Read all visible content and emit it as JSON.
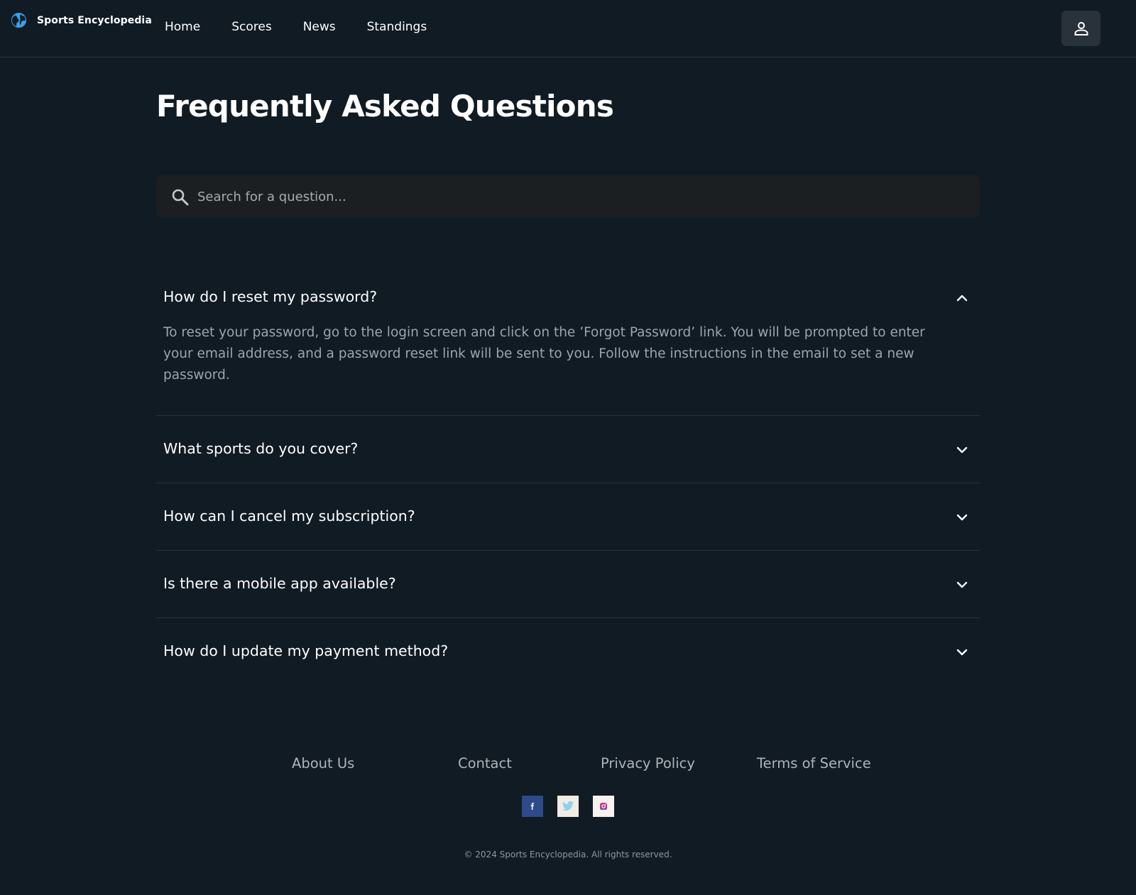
{
  "header": {
    "brand_name": "Sports Encyclopedia",
    "brand_icon": "globe-icon",
    "nav": [
      {
        "label": "Home"
      },
      {
        "label": "Scores"
      },
      {
        "label": "News"
      },
      {
        "label": "Standings"
      }
    ],
    "user_icon": "user-icon"
  },
  "main": {
    "title": "Frequently Asked Questions",
    "search": {
      "placeholder": "Search for a question...",
      "value": "",
      "icon": "search-icon"
    },
    "faqs": [
      {
        "question": "How do I reset my password?",
        "expanded": true,
        "answer": "To reset your password, go to the login screen and click on the ’Forgot Password’ link. You will be prompted to enter your email address, and a password reset link will be sent to you. Follow the instructions in the email to set a new password."
      },
      {
        "question": "What sports do you cover?",
        "expanded": false
      },
      {
        "question": "How can I cancel my subscription?",
        "expanded": false
      },
      {
        "question": "Is there a mobile app available?",
        "expanded": false
      },
      {
        "question": "How do I update my payment method?",
        "expanded": false
      }
    ]
  },
  "footer": {
    "links": [
      {
        "label": "About Us"
      },
      {
        "label": "Contact"
      },
      {
        "label": "Privacy Policy"
      },
      {
        "label": "Terms of Service"
      }
    ],
    "social": [
      {
        "name": "facebook-icon",
        "color": "#2d4a8a"
      },
      {
        "name": "twitter-icon",
        "color": "#f1ebe4"
      },
      {
        "name": "instagram-icon",
        "color": "#f6f3ef"
      }
    ],
    "copyright": "© 2024 Sports Encyclopedia. All rights reserved."
  },
  "colors": {
    "background": "#111b23",
    "accent": "#3aa0e8",
    "search_bg": "#1b1f22",
    "button_bg": "#29323a"
  }
}
